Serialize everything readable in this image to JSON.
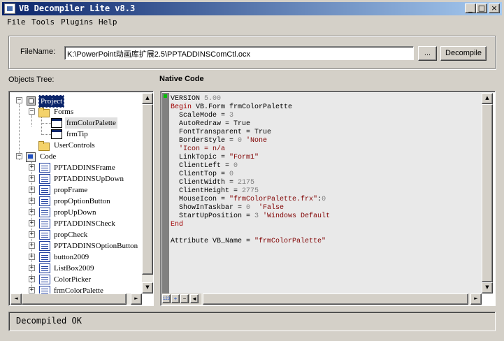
{
  "window": {
    "title": "VB Decompiler Lite v8.3",
    "minimize": "_",
    "maximize": "□",
    "close": "×"
  },
  "menu": [
    "File",
    "Tools",
    "Plugins",
    "Help"
  ],
  "file": {
    "label": "FileName:",
    "value": "K:\\PowerPoint动画库扩展2.5\\PPTADDINSComCtl.ocx",
    "browse_label": "...",
    "decompile_label": "Decompile"
  },
  "labels": {
    "objects_tree": "Objects Tree:",
    "native_code": "Native Code"
  },
  "tree": {
    "project": "Project",
    "forms": "Forms",
    "form_items": [
      "frmColorPalette",
      "frmTip"
    ],
    "user_controls": "UserControls",
    "code": "Code",
    "code_items": [
      "PPTADDINSFrame",
      "PPTADDINSUpDown",
      "propFrame",
      "propOptionButton",
      "propUpDown",
      "PPTADDINSCheck",
      "propCheck",
      "PPTADDINSOptionButton",
      "button2009",
      "ListBox2009",
      "ColorPicker",
      "frmColorPalette"
    ]
  },
  "code_lines": [
    {
      "t": "VERSION ",
      "n": "5.00"
    },
    {
      "k": "Begin",
      "t": " VB.Form frmColorPalette"
    },
    {
      "t": "  ScaleMode = ",
      "n": "3"
    },
    {
      "t": "  AutoRedraw = True"
    },
    {
      "t": "  FontTransparent = True"
    },
    {
      "t": "  BorderStyle = ",
      "n": "0",
      "s": " 'None"
    },
    {
      "s": "  'Icon = n/a"
    },
    {
      "t": "  LinkTopic = ",
      "s": "\"Form1\""
    },
    {
      "t": "  ClientLeft = ",
      "n": "0"
    },
    {
      "t": "  ClientTop = ",
      "n": "0"
    },
    {
      "t": "  ClientWidth = ",
      "n": "2175"
    },
    {
      "t": "  ClientHeight = ",
      "n": "2775"
    },
    {
      "t": "  MouseIcon = ",
      "s": "\"frmColorPalette.frx\"",
      "t2": ":",
      "n2": "0"
    },
    {
      "t": "  ShowInTaskbar = ",
      "n": "0",
      "s": "  'False"
    },
    {
      "t": "  StartUpPosition = ",
      "n": "3",
      "s": " 'Windows Default"
    },
    {
      "k": "End"
    },
    {
      "t": ""
    },
    {
      "t": "Attribute VB_Name = ",
      "s": "\"frmColorPalette\""
    }
  ],
  "code_toolbar": [
    "123",
    "+",
    "−",
    "◄"
  ],
  "status": "Decompiled OK",
  "colors": {
    "title_start": "#0a246a",
    "title_end": "#a6caf0",
    "keyword": "#a00000",
    "number": "#808080",
    "string": "#800000"
  }
}
